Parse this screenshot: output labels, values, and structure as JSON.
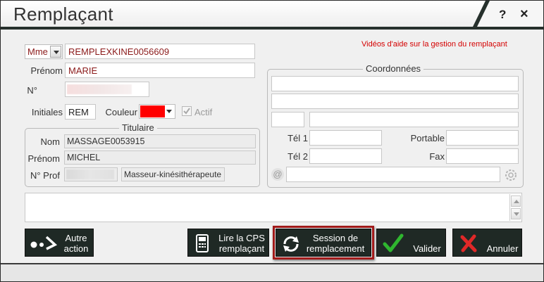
{
  "window": {
    "title": "Remplaçant",
    "help_label": "?",
    "close_label": "×"
  },
  "identity": {
    "civility": "Mme",
    "name": "REMPLEXKINE0056609",
    "prenom_label": "Prénom",
    "prenom": "MARIE",
    "num_label": "N°",
    "initiales_label": "Initiales",
    "initiales": "REM",
    "couleur_label": "Couleur",
    "couleur_value": "#ff0000",
    "actif_label": "Actif",
    "actif_checked": true
  },
  "help_link": "Vidéos d'aide sur la gestion du remplaçant",
  "titulaire": {
    "group_title": "Titulaire",
    "nom_label": "Nom",
    "nom": "MASSAGE0053915",
    "prenom_label": "Prénom",
    "prenom": "MICHEL",
    "nprof_label": "N° Prof",
    "profession": "Masseur-kinésithérapeute"
  },
  "coordonnees": {
    "group_title": "Coordonnées",
    "tel1_label": "Tél 1",
    "tel2_label": "Tél 2",
    "portable_label": "Portable",
    "fax_label": "Fax",
    "email_icon": "@"
  },
  "buttons": {
    "autre_line1": "Autre",
    "autre_line2": "action",
    "cps_line1": "Lire la CPS",
    "cps_line2": "remplaçant",
    "session_line1": "Session de",
    "session_line2": "remplacement",
    "valider": "Valider",
    "annuler": "Annuler"
  },
  "colors": {
    "accent_red": "#8b1a1a",
    "button_bg": "#1f2925",
    "valider_green": "#2fb62f",
    "annuler_red": "#e02828"
  }
}
